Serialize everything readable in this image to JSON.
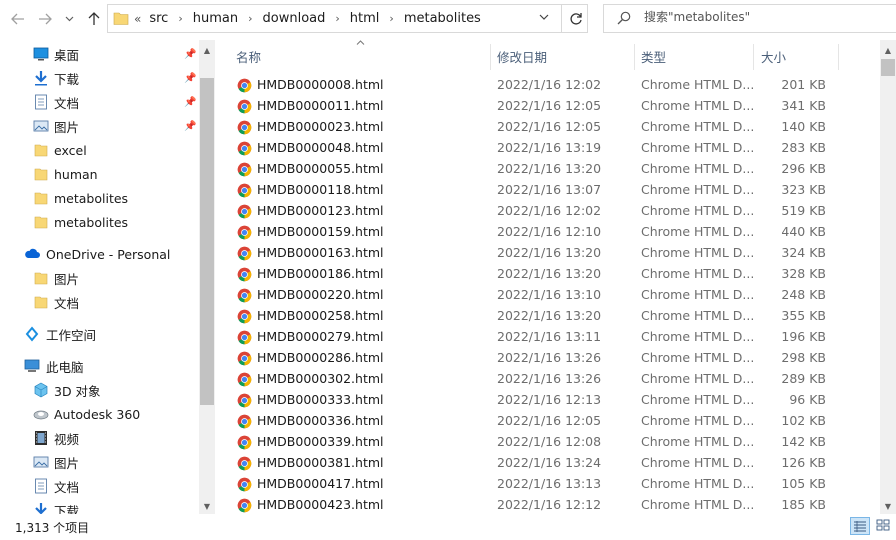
{
  "nav": {
    "back_icon": "back-arrow-icon",
    "forward_icon": "forward-arrow-icon",
    "recent_icon": "chevron-down-icon",
    "up_icon": "up-arrow-icon"
  },
  "address": {
    "overflow": "«",
    "crumbs": [
      "src",
      "human",
      "download",
      "html",
      "metabolites"
    ]
  },
  "search": {
    "placeholder": "搜索\"metabolites\""
  },
  "sidebar": {
    "items": [
      {
        "label": "桌面",
        "icon": "desktop-icon",
        "pinned": true
      },
      {
        "label": "下载",
        "icon": "download-icon",
        "pinned": true
      },
      {
        "label": "文档",
        "icon": "document-icon",
        "pinned": true
      },
      {
        "label": "图片",
        "icon": "pictures-icon",
        "pinned": true
      },
      {
        "label": "excel",
        "icon": "folder-icon",
        "pinned": false
      },
      {
        "label": "human",
        "icon": "folder-icon",
        "pinned": false
      },
      {
        "label": "metabolites",
        "icon": "folder-icon",
        "pinned": false
      },
      {
        "label": "metabolites",
        "icon": "folder-icon",
        "pinned": false
      },
      {
        "label": "OneDrive - Personal",
        "icon": "cloud-icon",
        "pinned": false
      },
      {
        "label": "图片",
        "icon": "folder-icon",
        "pinned": false
      },
      {
        "label": "文档",
        "icon": "folder-icon",
        "pinned": false
      },
      {
        "label": "工作空间",
        "icon": "workspace-icon",
        "pinned": false
      },
      {
        "label": "此电脑",
        "icon": "computer-icon",
        "pinned": false
      },
      {
        "label": "3D 对象",
        "icon": "3d-objects-icon",
        "pinned": false
      },
      {
        "label": "Autodesk 360",
        "icon": "autodesk-icon",
        "pinned": false
      },
      {
        "label": "视频",
        "icon": "video-icon",
        "pinned": false
      },
      {
        "label": "图片",
        "icon": "pictures-icon",
        "pinned": false
      },
      {
        "label": "文档",
        "icon": "document-icon",
        "pinned": false
      },
      {
        "label": "下载",
        "icon": "download-icon",
        "pinned": false
      }
    ]
  },
  "columns": {
    "name": "名称",
    "date": "修改日期",
    "type": "类型",
    "size": "大小"
  },
  "files": [
    {
      "name": "HMDB0000008.html",
      "date": "2022/1/16 12:02",
      "type": "Chrome HTML D...",
      "size": "201 KB"
    },
    {
      "name": "HMDB0000011.html",
      "date": "2022/1/16 12:05",
      "type": "Chrome HTML D...",
      "size": "341 KB"
    },
    {
      "name": "HMDB0000023.html",
      "date": "2022/1/16 12:05",
      "type": "Chrome HTML D...",
      "size": "140 KB"
    },
    {
      "name": "HMDB0000048.html",
      "date": "2022/1/16 13:19",
      "type": "Chrome HTML D...",
      "size": "283 KB"
    },
    {
      "name": "HMDB0000055.html",
      "date": "2022/1/16 13:20",
      "type": "Chrome HTML D...",
      "size": "296 KB"
    },
    {
      "name": "HMDB0000118.html",
      "date": "2022/1/16 13:07",
      "type": "Chrome HTML D...",
      "size": "323 KB"
    },
    {
      "name": "HMDB0000123.html",
      "date": "2022/1/16 12:02",
      "type": "Chrome HTML D...",
      "size": "519 KB"
    },
    {
      "name": "HMDB0000159.html",
      "date": "2022/1/16 12:10",
      "type": "Chrome HTML D...",
      "size": "440 KB"
    },
    {
      "name": "HMDB0000163.html",
      "date": "2022/1/16 13:20",
      "type": "Chrome HTML D...",
      "size": "324 KB"
    },
    {
      "name": "HMDB0000186.html",
      "date": "2022/1/16 13:20",
      "type": "Chrome HTML D...",
      "size": "328 KB"
    },
    {
      "name": "HMDB0000220.html",
      "date": "2022/1/16 13:10",
      "type": "Chrome HTML D...",
      "size": "248 KB"
    },
    {
      "name": "HMDB0000258.html",
      "date": "2022/1/16 13:20",
      "type": "Chrome HTML D...",
      "size": "355 KB"
    },
    {
      "name": "HMDB0000279.html",
      "date": "2022/1/16 13:11",
      "type": "Chrome HTML D...",
      "size": "196 KB"
    },
    {
      "name": "HMDB0000286.html",
      "date": "2022/1/16 13:26",
      "type": "Chrome HTML D...",
      "size": "298 KB"
    },
    {
      "name": "HMDB0000302.html",
      "date": "2022/1/16 13:26",
      "type": "Chrome HTML D...",
      "size": "289 KB"
    },
    {
      "name": "HMDB0000333.html",
      "date": "2022/1/16 12:13",
      "type": "Chrome HTML D...",
      "size": "96 KB"
    },
    {
      "name": "HMDB0000336.html",
      "date": "2022/1/16 12:05",
      "type": "Chrome HTML D...",
      "size": "102 KB"
    },
    {
      "name": "HMDB0000339.html",
      "date": "2022/1/16 12:08",
      "type": "Chrome HTML D...",
      "size": "142 KB"
    },
    {
      "name": "HMDB0000381.html",
      "date": "2022/1/16 13:24",
      "type": "Chrome HTML D...",
      "size": "126 KB"
    },
    {
      "name": "HMDB0000417.html",
      "date": "2022/1/16 13:13",
      "type": "Chrome HTML D...",
      "size": "105 KB"
    },
    {
      "name": "HMDB0000423.html",
      "date": "2022/1/16 12:12",
      "type": "Chrome HTML D...",
      "size": "185 KB"
    }
  ],
  "status": {
    "item_count": "1,313 个项目",
    "details_view_icon": "details-view-icon",
    "tiles_view_icon": "large-icons-view-icon"
  },
  "colors": {
    "accent": "#0078d7",
    "header_text": "#4c607a",
    "folder": "#f8d775",
    "chrome_red": "#db4437",
    "chrome_green": "#0f9d58",
    "chrome_yellow": "#f4b400",
    "chrome_blue": "#4285f4"
  }
}
